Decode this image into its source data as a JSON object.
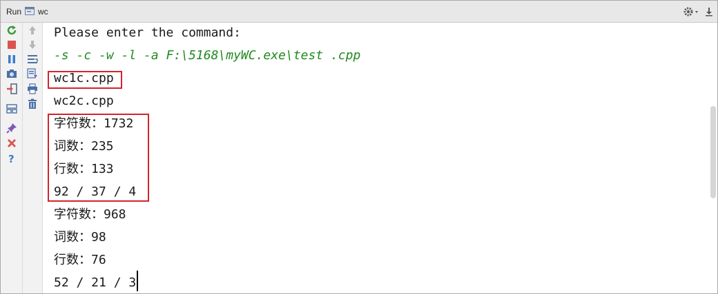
{
  "titlebar": {
    "run_label": "Run",
    "config_name": "wc"
  },
  "left_toolbar": [
    {
      "icon": "rerun-icon"
    },
    {
      "icon": "stop-icon"
    },
    {
      "icon": "pause-icon"
    },
    {
      "icon": "camera-icon"
    },
    {
      "icon": "exit-icon"
    },
    {
      "icon": "layout-icon"
    },
    {
      "icon": "pin-icon"
    },
    {
      "icon": "close-icon"
    },
    {
      "icon": "help-icon"
    }
  ],
  "second_toolbar": [
    {
      "icon": "up-arrow-icon"
    },
    {
      "icon": "down-arrow-icon"
    },
    {
      "icon": "soft-wrap-icon"
    },
    {
      "icon": "scroll-to-end-icon"
    },
    {
      "icon": "print-icon"
    },
    {
      "icon": "trash-icon"
    }
  ],
  "console": {
    "lines": [
      {
        "text": "Please enter the command:",
        "kind": "output"
      },
      {
        "text": "-s -c -w -l -a F:\\5168\\myWC.exe\\test .cpp",
        "kind": "input"
      },
      {
        "text": "wc1c.cpp",
        "kind": "output"
      },
      {
        "text": "wc2c.cpp",
        "kind": "output"
      },
      {
        "text": "字符数：1732",
        "kind": "output"
      },
      {
        "text": "词数：235",
        "kind": "output"
      },
      {
        "text": "行数：133",
        "kind": "output"
      },
      {
        "text": "92 / 37 / 4",
        "kind": "output"
      },
      {
        "text": "字符数：968",
        "kind": "output"
      },
      {
        "text": "词数：98",
        "kind": "output"
      },
      {
        "text": "行数：76",
        "kind": "output"
      },
      {
        "text": "52 / 21 / 3",
        "kind": "output"
      }
    ]
  },
  "colors": {
    "highlight": "#d2232a",
    "input_text": "#1f8a1f"
  }
}
